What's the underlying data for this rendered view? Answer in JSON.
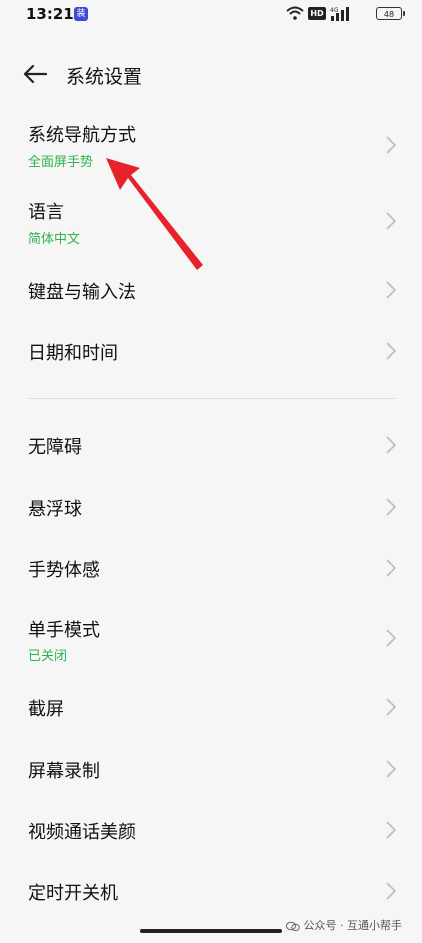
{
  "status_bar": {
    "time": "13:21",
    "app_badge": "装",
    "hd": "HD",
    "battery": "48"
  },
  "header": {
    "title": "系统设置"
  },
  "items": [
    {
      "title": "系统导航方式",
      "subtitle": "全面屏手势"
    },
    {
      "title": "语言",
      "subtitle": "简体中文"
    },
    {
      "title": "键盘与输入法"
    },
    {
      "title": "日期和时间"
    },
    {
      "title": "无障碍"
    },
    {
      "title": "悬浮球"
    },
    {
      "title": "手势体感"
    },
    {
      "title": "单手模式",
      "subtitle": "已关闭"
    },
    {
      "title": "截屏"
    },
    {
      "title": "屏幕录制"
    },
    {
      "title": "视频通话美颜"
    },
    {
      "title": "定时开关机"
    }
  ],
  "watermark": "公众号 · 互通小帮手",
  "colors": {
    "accent_green": "#2fb34a",
    "annotation_red": "#e8212b"
  }
}
